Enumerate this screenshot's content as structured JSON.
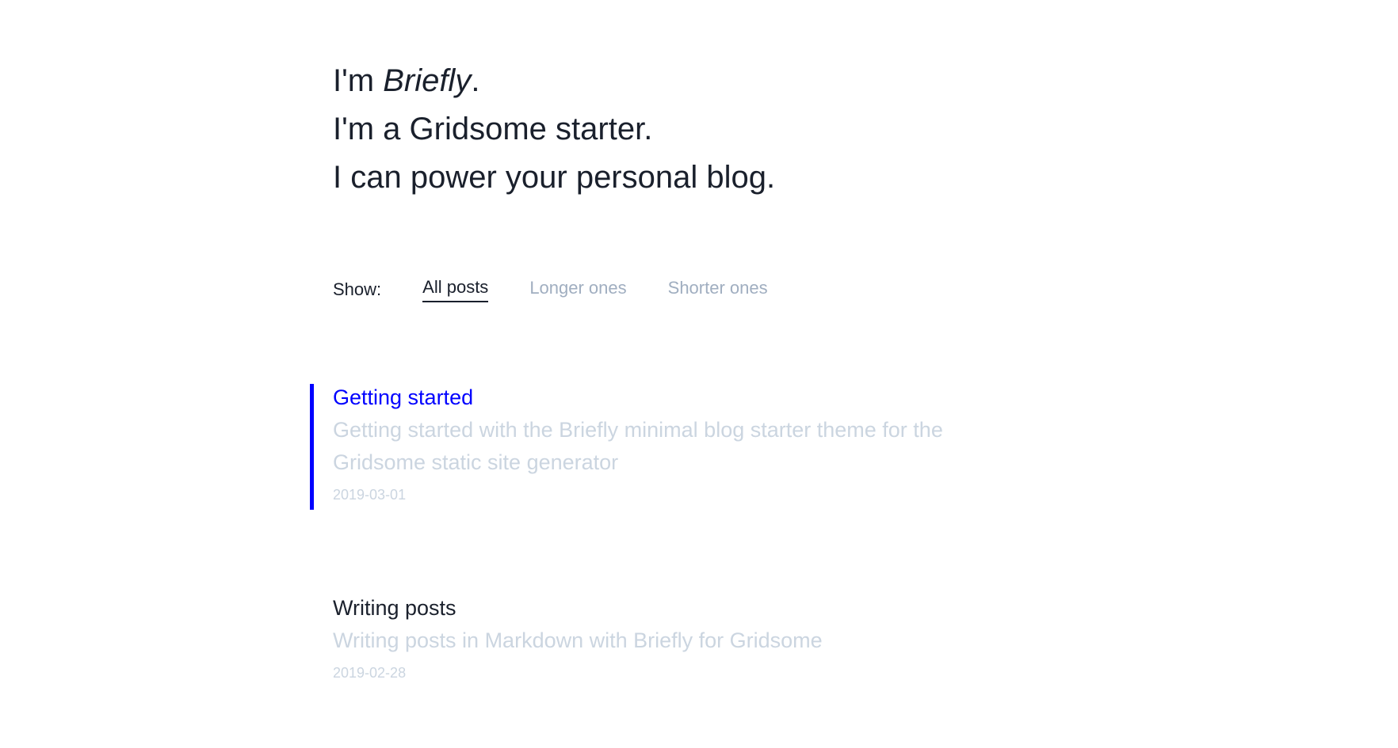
{
  "hero": {
    "line1_prefix": "I'm ",
    "line1_name": "Briefly",
    "line1_suffix": ".",
    "line2": "I'm a Gridsome starter.",
    "line3": "I can power your personal blog."
  },
  "filter": {
    "label": "Show:",
    "options": [
      {
        "label": "All posts",
        "active": true
      },
      {
        "label": "Longer ones",
        "active": false
      },
      {
        "label": "Shorter ones",
        "active": false
      }
    ]
  },
  "posts": [
    {
      "title": "Getting started",
      "description": "Getting started with the Briefly minimal blog starter theme for the Gridsome static site generator",
      "date": "2019-03-01"
    },
    {
      "title": "Writing posts",
      "description": "Writing posts in Markdown with Briefly for Gridsome",
      "date": "2019-02-28"
    }
  ],
  "colors": {
    "accent": "#0000ff",
    "text": "#1a202c",
    "muted": "#a0aec0",
    "faint": "#cbd5e0"
  }
}
